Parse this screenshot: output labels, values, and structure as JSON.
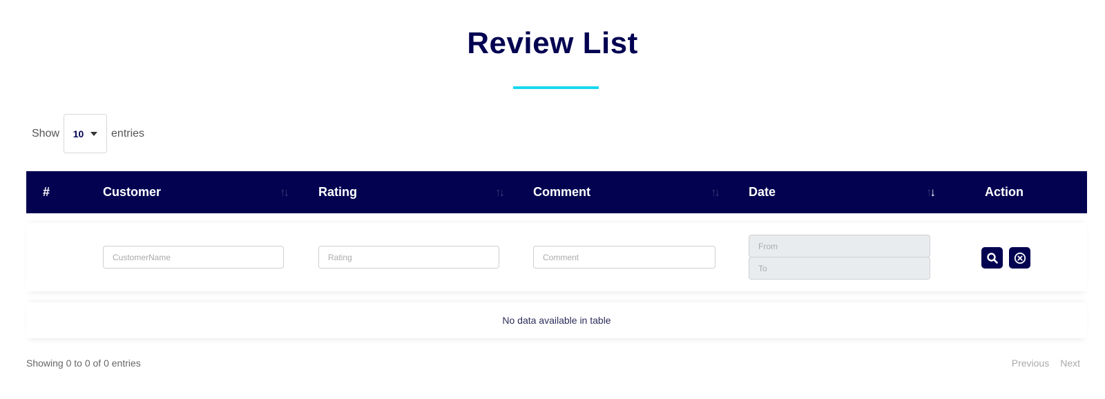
{
  "page": {
    "title": "Review List",
    "accent_color": "#17d8f0",
    "brand_color": "#020251"
  },
  "length_control": {
    "prefix": "Show",
    "selected": "10",
    "suffix": "entries"
  },
  "table": {
    "columns": [
      {
        "label": "#",
        "sortable": false
      },
      {
        "label": "Customer",
        "sortable": true,
        "sort_state": "none"
      },
      {
        "label": "Rating",
        "sortable": true,
        "sort_state": "none"
      },
      {
        "label": "Comment",
        "sortable": true,
        "sort_state": "none"
      },
      {
        "label": "Date",
        "sortable": true,
        "sort_state": "descending"
      },
      {
        "label": "Action",
        "sortable": false
      }
    ],
    "sort_icon": {
      "up": "↑",
      "down": "↓"
    },
    "filters": {
      "customer_placeholder": "CustomerName",
      "rating_placeholder": "Rating",
      "comment_placeholder": "Comment",
      "date_from_placeholder": "From",
      "date_to_placeholder": "To",
      "search_icon": "search-icon",
      "clear_icon": "clear-circle-icon"
    },
    "empty_message": "No data available in table"
  },
  "footer": {
    "info": "Showing 0 to 0 of 0 entries",
    "previous_label": "Previous",
    "next_label": "Next"
  }
}
